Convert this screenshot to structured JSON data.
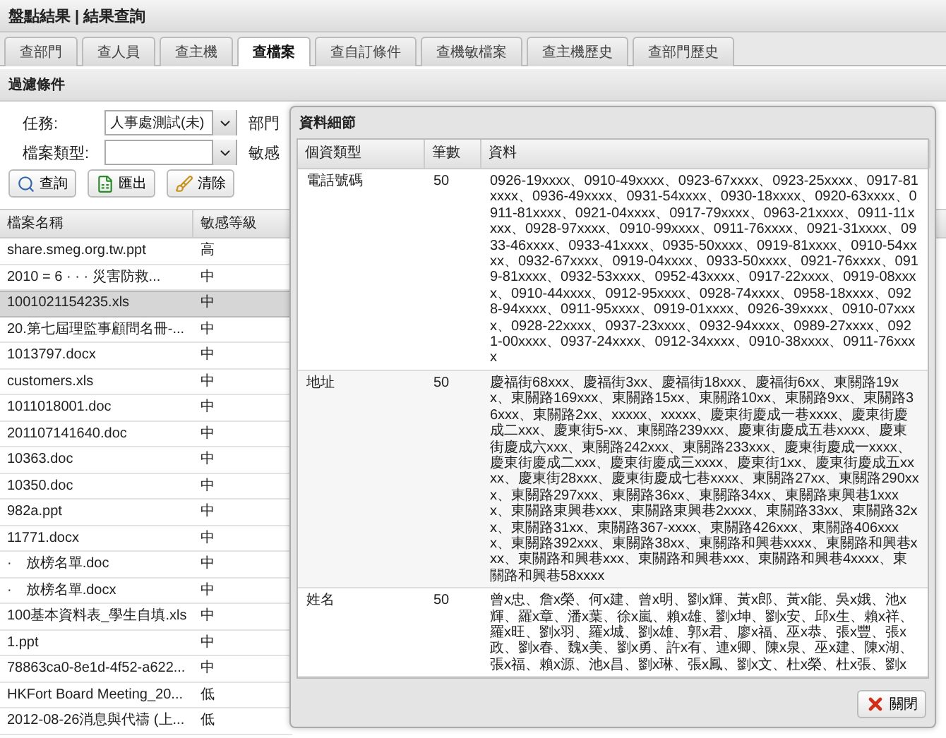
{
  "breadcrumb": "盤點結果 | 結果查詢",
  "tabs": [
    {
      "label": "查部門",
      "selected": false
    },
    {
      "label": "查人員",
      "selected": false
    },
    {
      "label": "查主機",
      "selected": false
    },
    {
      "label": "查檔案",
      "selected": true
    },
    {
      "label": "查自訂條件",
      "selected": false
    },
    {
      "label": "查機敏檔案",
      "selected": false
    },
    {
      "label": "查主機歷史",
      "selected": false
    },
    {
      "label": "查部門歷史",
      "selected": false
    }
  ],
  "filter": {
    "title": "過濾條件",
    "fields": [
      {
        "label": "任務:",
        "value": "人事處測試(未)",
        "side_label": "部門"
      },
      {
        "label": "檔案類型:",
        "side_label": "敏感"
      }
    ],
    "buttons": [
      {
        "kind": "search",
        "label": "查詢"
      },
      {
        "kind": "export",
        "label": "匯出"
      },
      {
        "kind": "clear",
        "label": "清除"
      }
    ]
  },
  "table": {
    "columns": [
      "檔案名稱",
      "敏感等級"
    ],
    "rows": [
      {
        "name": "share.smeg.org.tw.ppt",
        "level": "高",
        "selected": false
      },
      {
        "name": "2010 = 6 · · · 災害防救...",
        "level": "中",
        "selected": false
      },
      {
        "name": "1001021154235.xls",
        "level": "中",
        "selected": true
      },
      {
        "name": "20.第七屆理監事顧問名冊-...",
        "level": "中",
        "selected": false
      },
      {
        "name": "1013797.docx",
        "level": "中",
        "selected": false
      },
      {
        "name": "customers.xls",
        "level": "中",
        "selected": false
      },
      {
        "name": "1011018001.doc",
        "level": "中",
        "selected": false
      },
      {
        "name": "201107141640.doc",
        "level": "中",
        "selected": false
      },
      {
        "name": "10363.doc",
        "level": "中",
        "selected": false
      },
      {
        "name": "10350.doc",
        "level": "中",
        "selected": false
      },
      {
        "name": "982a.ppt",
        "level": "中",
        "selected": false
      },
      {
        "name": "11771.docx",
        "level": "中",
        "selected": false
      },
      {
        "name": "·　放榜名單.doc",
        "level": "中",
        "selected": false
      },
      {
        "name": "·　放榜名單.docx",
        "level": "中",
        "selected": false
      },
      {
        "name": "100基本資料表_學生自填.xls",
        "level": "中",
        "selected": false
      },
      {
        "name": "1.ppt",
        "level": "中",
        "selected": false
      },
      {
        "name": "78863ca0-8e1d-4f52-a622...",
        "level": "中",
        "selected": false
      },
      {
        "name": "HKFort Board Meeting_20...",
        "level": "低",
        "selected": false
      },
      {
        "name": "2012-08-26消息與代禱 (上...",
        "level": "低",
        "selected": false
      }
    ]
  },
  "dialog": {
    "title": "資料細節",
    "columns": [
      "個資類型",
      "筆數",
      "資料"
    ],
    "rows": [
      {
        "type": "電話號碼",
        "count": "50",
        "data": "0926-19xxxx、0910-49xxxx、0923-67xxxx、0923-25xxxx、0917-81xxxx、0936-49xxxx、0931-54xxxx、0930-18xxxx、0920-63xxxx、0911-81xxxx、0921-04xxxx、0917-79xxxx、0963-21xxxx、0911-11xxxx、0928-97xxxx、0910-99xxxx、0911-76xxxx、0921-31xxxx、0933-46xxxx、0933-41xxxx、0935-50xxxx、0919-81xxxx、0910-54xxxx、0932-67xxxx、0919-04xxxx、0933-50xxxx、0921-76xxxx、0919-81xxxx、0932-53xxxx、0952-43xxxx、0917-22xxxx、0919-08xxxx、0910-44xxxx、0912-95xxxx、0928-74xxxx、0958-18xxxx、0928-94xxxx、0911-95xxxx、0919-01xxxx、0926-39xxxx、0910-07xxxx、0928-22xxxx、0937-23xxxx、0932-94xxxx、0989-27xxxx、0921-00xxxx、0937-24xxxx、0912-34xxxx、0910-38xxxx、0911-76xxxx"
      },
      {
        "type": "地址",
        "count": "50",
        "data": "慶福街68xxx、慶福街3xx、慶福街18xxx、慶福街6xx、東關路19xx、東關路169xxx、東關路15xx、東關路10xx、東關路9xx、東關路36xxx、東關路2xx、xxxxx、xxxxx、慶東街慶成一巷xxxx、慶東街慶成二xxx、慶東街5-xx、東關路239xxx、慶東街慶成五巷xxxx、慶東街慶成六xxx、東關路242xxx、東關路233xxx、慶東街慶成一xxxx、慶東街慶成二xxx、慶東街慶成三xxxx、慶東街1xx、慶東街慶成五xxxx、慶東街28xxx、慶東街慶成七巷xxxx、東關路27xx、東關路290xxx、東關路297xxx、東關路36xx、東關路34xx、東關路東興巷1xxxx、東關路東興巷xxx、東關路東興巷2xxxx、東關路33xx、東關路32xx、東關路31xx、東關路367-xxxx、東關路426xxx、東關路406xxxx、東關路392xxx、東關路38xx、東關路和興巷xxxx、東關路和興巷xxx、東關路和興巷xxx、東關路和興巷xxx、東關路和興巷4xxxx、東關路和興巷58xxxx"
      },
      {
        "type": "姓名",
        "count": "50",
        "data": "曾x忠、詹x榮、何x建、曾x明、劉x輝、黃x郎、黃x能、吳x娥、池x輝、羅x章、潘x葉、徐x嵐、賴x雄、劉x坤、劉x安、邱x生、賴x祥、羅x旺、劉x羽、羅x城、劉x雄、郭x君、廖x福、巫x恭、張x豐、張x政、劉x春、魏x美、劉x勇、許x有、連x卿、陳x泉、巫x建、陳x湖、張x福、賴x源、池x昌、劉x琳、張x鳳、劉x文、杜x榮、杜x張、劉x"
      }
    ],
    "close_button": "關閉"
  }
}
